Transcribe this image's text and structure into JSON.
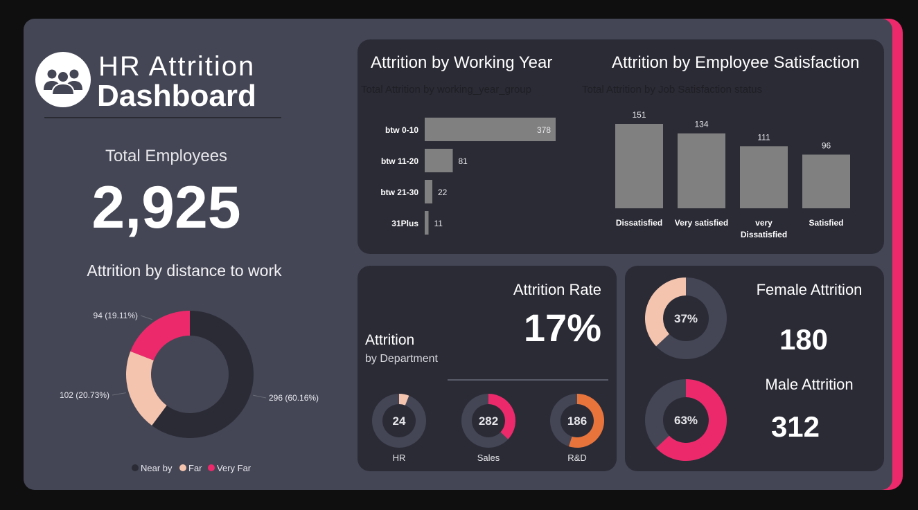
{
  "header": {
    "title_line1": "HR Attrition",
    "title_line2": "Dashboard",
    "logo_icon": "people-group-icon"
  },
  "kpi": {
    "total_label": "Total Employees",
    "total_value": "2,925"
  },
  "distance": {
    "title": "Attrition by distance to work",
    "legend": [
      "Near by",
      "Far",
      "Very Far"
    ]
  },
  "working_year": {
    "title": "Attrition by Working Year",
    "subtitle": "Total Attrition by working_year_group"
  },
  "satisfaction": {
    "title": "Attrition by Employee Satisfaction",
    "subtitle": "Total Attrition by Job Satisfaction status"
  },
  "department": {
    "title": "Attrition",
    "subtitle": "by Department",
    "rate_label": "Attrition Rate",
    "rate_value": "17%"
  },
  "gender": {
    "female_label": "Female Attrition",
    "female_value": "180",
    "male_label": "Male Attrition",
    "male_value": "312"
  },
  "colors": {
    "near": "#2b2b36",
    "far": "#f4c4ae",
    "very_far": "#ec2a6b",
    "bar": "#808080",
    "ring_bg": "#444655",
    "rnd": "#e8743b"
  },
  "chart_data": [
    {
      "id": "distance",
      "type": "pie",
      "categories": [
        "Near by",
        "Far",
        "Very Far"
      ],
      "values": [
        296,
        102,
        94
      ],
      "labels": [
        "296 (60.16%)",
        "102 (20.73%)",
        "94 (19.11%)"
      ],
      "title": "Attrition by distance to work",
      "legend": "bottom"
    },
    {
      "id": "working_year",
      "type": "bar",
      "orientation": "horizontal",
      "categories": [
        "btw 0-10",
        "btw 11-20",
        "btw 21-30",
        "31Plus"
      ],
      "values": [
        378,
        81,
        22,
        11
      ],
      "title": "Attrition by Working Year",
      "xlim": [
        0,
        378
      ]
    },
    {
      "id": "satisfaction",
      "type": "bar",
      "categories": [
        "Dissatisfied",
        "Very satisfied",
        "very Dissatisfied",
        "Satisfied"
      ],
      "values": [
        151,
        134,
        111,
        96
      ],
      "title": "Attrition by Employee Satisfaction",
      "ylim": [
        0,
        151
      ]
    },
    {
      "id": "department",
      "type": "pie",
      "categories": [
        "HR",
        "Sales",
        "R&D"
      ],
      "values": [
        24,
        282,
        186
      ],
      "fractions": [
        0.06,
        0.37,
        0.55
      ]
    },
    {
      "id": "gender",
      "type": "pie",
      "categories": [
        "Female",
        "Male"
      ],
      "values": [
        180,
        312
      ],
      "labels": [
        "37%",
        "63%"
      ],
      "fractions": [
        0.37,
        0.63
      ]
    }
  ]
}
